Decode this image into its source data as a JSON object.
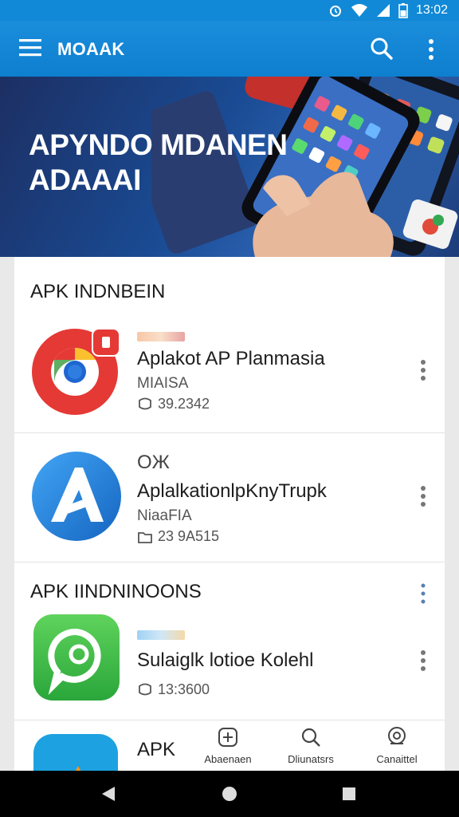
{
  "status_bar": {
    "time": "13:02"
  },
  "app_bar": {
    "title": "MOAAK"
  },
  "hero": {
    "headline_line1": "APYNDO MDANEN",
    "headline_line2": "ADAAAI"
  },
  "section1": {
    "title": "APK INDNBEIN",
    "items": [
      {
        "name": "Aplakot AP Planmasia",
        "subtitle": "MIAISA",
        "meta": "39.2342"
      },
      {
        "name": "AplalkationlpKnyTrupk",
        "top_label": "OЖ",
        "subtitle": "NiaaFIA",
        "meta": "23 9A515"
      }
    ]
  },
  "section2": {
    "title": "APK IINDNINOONS",
    "items": [
      {
        "name": "Sulaiglk lotioe Kolehl",
        "meta": "13:3600"
      },
      {
        "name": "APK"
      }
    ]
  },
  "bottom_tabs": [
    {
      "label": "Abaenaen",
      "icon": "add-box-icon"
    },
    {
      "label": "Dliunatsrs",
      "icon": "search-icon"
    },
    {
      "label": "Canaittel",
      "icon": "account-icon"
    }
  ],
  "colors": {
    "primary": "#1189d6",
    "hero_dark": "#1c2f63"
  }
}
